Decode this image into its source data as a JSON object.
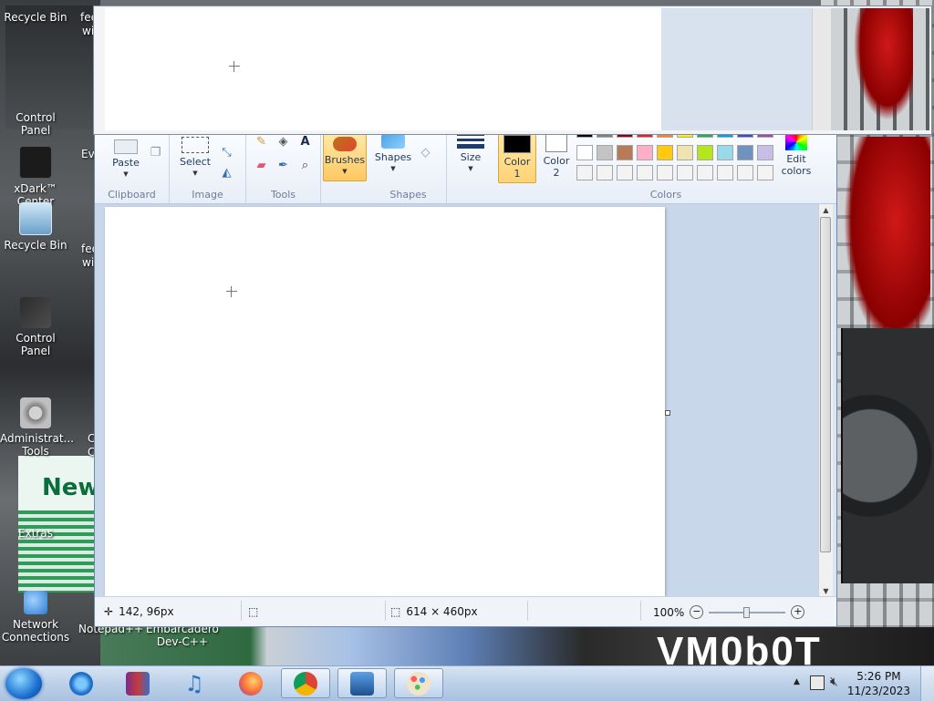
{
  "desktop": {
    "icons": [
      {
        "label": "Recycle Bin",
        "icon": "recycle-bin-icon"
      },
      {
        "label": "xDark™\nCenter",
        "icon": "xdark-icon"
      },
      {
        "label": "Recycle Bin",
        "icon": "recycle-bin-icon"
      },
      {
        "label": "Control Panel",
        "icon": "control-panel-icon"
      },
      {
        "label": "Administrat...\nTools",
        "icon": "admin-tools-icon"
      },
      {
        "label": "Extras",
        "icon": "extras-icon"
      },
      {
        "label": "Network\nConnections",
        "icon": "network-icon"
      },
      {
        "label": "Notepad++",
        "icon": "notepad-icon"
      },
      {
        "label": "Embarcadero\nDev-C++",
        "icon": "devcpp-icon"
      }
    ],
    "partial_labels": [
      "fee",
      "wi",
      "Ev",
      "fee",
      "wi",
      "F",
      "C",
      "C",
      "Control Panel",
      "F"
    ],
    "wallpaper_text": "VM0b0T"
  },
  "preview_window": {
    "recycle_label": "Recycle Bin",
    "control_label": "Control Panel",
    "partial": "fee",
    "partial2": "wi"
  },
  "paint": {
    "ribbon": {
      "clipboard": {
        "group_label": "Clipboard",
        "paste_label": "Paste"
      },
      "image": {
        "group_label": "Image",
        "select_label": "Select"
      },
      "tools": {
        "group_label": "Tools"
      },
      "brushes_label": "Brushes",
      "shapes": {
        "group_label": "Shapes",
        "shapes_label": "Shapes"
      },
      "size_label": "Size",
      "colors": {
        "group_label": "Colors",
        "color1_label": "Color\n1",
        "color2_label": "Color\n2",
        "edit_colors_label": "Edit\ncolors",
        "color1_value": "#000000",
        "color2_value": "#ffffff",
        "palette_row1": [
          "#000000",
          "#7f7f7f",
          "#880015",
          "#ed1c24",
          "#ff7f27",
          "#fff200",
          "#22b14c",
          "#00a2e8",
          "#3f48cc",
          "#a349a4"
        ],
        "palette_row2": [
          "#ffffff",
          "#c3c3c3",
          "#b97a57",
          "#ffaec9",
          "#ffc90e",
          "#efe4b0",
          "#b5e61d",
          "#99d9ea",
          "#7092be",
          "#c8bfe7"
        ]
      }
    },
    "status": {
      "cursor_pos": "142, 96px",
      "selection_size": "",
      "canvas_size": "614 × 460px",
      "zoom": "100%"
    }
  },
  "taskbar": {
    "clock_time": "5:26 PM",
    "clock_date": "11/23/2023",
    "pinned": [
      "internet-explorer-icon",
      "winrar-icon",
      "music-icon",
      "firefox-icon",
      "chrome-icon",
      "remote-desktop-icon",
      "paint-icon"
    ]
  }
}
